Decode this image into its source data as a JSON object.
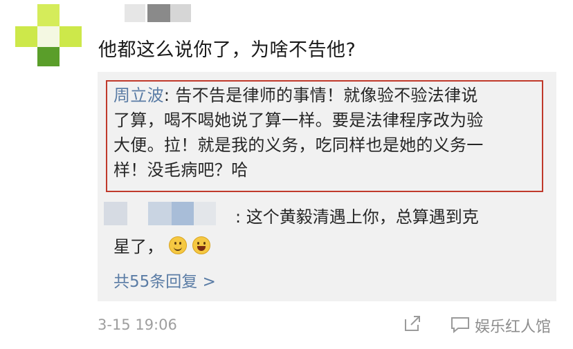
{
  "comment": {
    "text": "他都这么说你了，为啥不告他?",
    "timestamp": "3-15 19:06"
  },
  "replies": {
    "first": {
      "author": "周立波",
      "separator": ": ",
      "lines": [
        "告不告是律师的事情！就像验不验法律说",
        "了算，喝不喝她说了算一样。要是法律程序改为验",
        "大便。拉！就是我的义务，吃同样也是她的义务一",
        "样！没毛病吧？哈"
      ]
    },
    "second": {
      "separator": ": ",
      "line1": "这个黄毅清遇上你，总算遇到克",
      "line2": "星了，"
    },
    "more_link": "共55条回复 >"
  },
  "watermark": "娱乐红人馆",
  "colors": {
    "link": "#5a7ca5",
    "highlight_border": "#c0392b",
    "panel_bg": "#f1f1f1",
    "avatar_green": "#cde84a",
    "avatar_dark_green": "#5a9e2a"
  },
  "icons": [
    "share-icon",
    "comment-icon",
    "smile-emoji-icon",
    "laugh-emoji-icon"
  ]
}
